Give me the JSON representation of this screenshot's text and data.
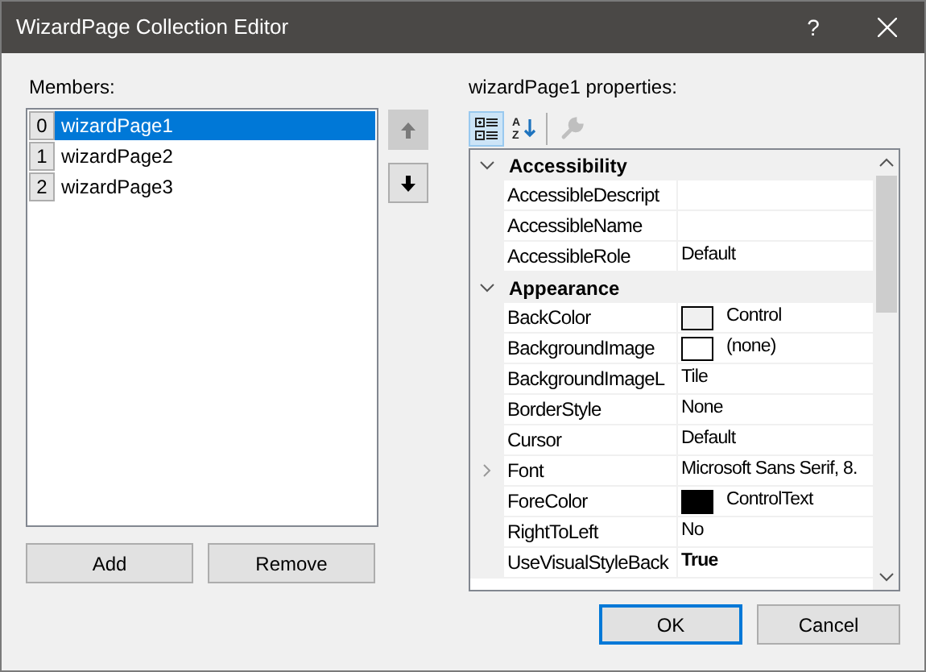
{
  "window": {
    "title": "WizardPage Collection Editor",
    "help": "?"
  },
  "members": {
    "label": "Members:",
    "items": [
      {
        "index": "0",
        "name": "wizardPage1",
        "selected": true
      },
      {
        "index": "1",
        "name": "wizardPage2",
        "selected": false
      },
      {
        "index": "2",
        "name": "wizardPage3",
        "selected": false
      }
    ]
  },
  "member_buttons": [
    "Add",
    "Remove"
  ],
  "properties": {
    "label": "wizardPage1 properties:",
    "toolbar": [
      {
        "kind": "categorized",
        "selected": true,
        "disabled": false
      },
      {
        "kind": "alphabetical",
        "selected": false,
        "disabled": false,
        "letters": [
          "A",
          "Z"
        ]
      },
      {
        "kind": "property-pages",
        "selected": false,
        "disabled": true
      }
    ],
    "categories": [
      {
        "name": "Accessibility",
        "expanded": true,
        "children": [
          {
            "name": "AccessibleDescript"
          },
          {
            "name": "AccessibleName"
          },
          {
            "name": "AccessibleRole",
            "value": "Default"
          }
        ]
      },
      {
        "name": "Appearance",
        "expanded": true,
        "children": [
          {
            "name": "BackColor",
            "value": "Control",
            "color": "#f0f0f0"
          },
          {
            "name": "BackgroundImage",
            "value": "(none)",
            "color": "#ffffff"
          },
          {
            "name": "BackgroundImageL",
            "value": "Tile"
          },
          {
            "name": "BorderStyle",
            "value": "None"
          },
          {
            "name": "Cursor",
            "value": "Default"
          },
          {
            "name": "Font",
            "value": "Microsoft Sans Serif, 8.",
            "expandable": true
          },
          {
            "name": "ForeColor",
            "value": "ControlText",
            "color": "#000000"
          },
          {
            "name": "RightToLeft",
            "value": "No"
          },
          {
            "name": "UseVisualStyleBack",
            "value": "True",
            "non_default": true
          }
        ]
      }
    ]
  },
  "dialog_buttons": [
    {
      "label": "OK",
      "default": true
    },
    {
      "label": "Cancel",
      "default": false
    }
  ]
}
